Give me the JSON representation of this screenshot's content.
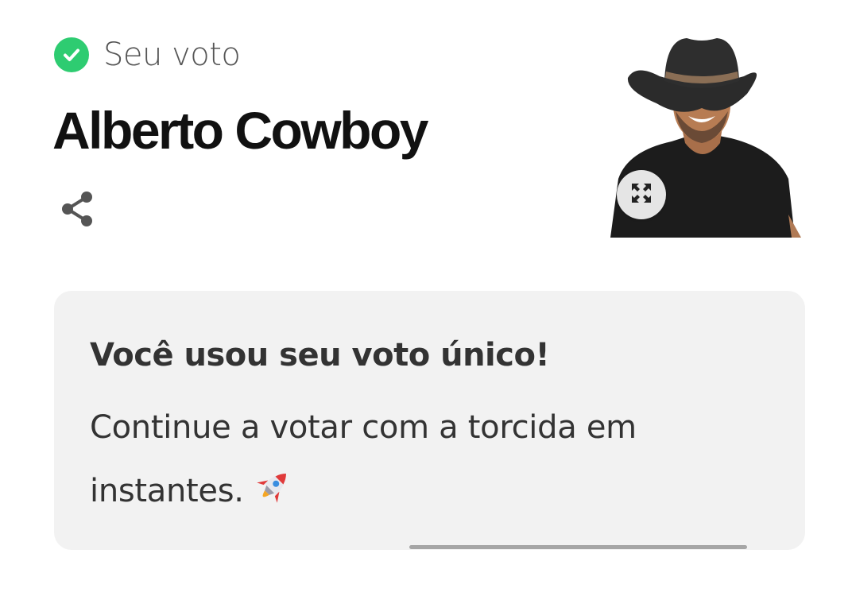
{
  "vote_status": {
    "label": "Seu voto",
    "icon": "check-circle-icon",
    "color": "#2ecc71"
  },
  "candidate": {
    "name": "Alberto Cowboy",
    "photo_alt": "Alberto Cowboy"
  },
  "actions": {
    "share_icon": "share-icon",
    "expand_icon": "expand-icon"
  },
  "message_card": {
    "title": "Você usou seu voto único!",
    "body": "Continue a votar com a torcida em instantes.",
    "emoji_icon": "rocket-icon",
    "progress_fraction": 1.0
  }
}
